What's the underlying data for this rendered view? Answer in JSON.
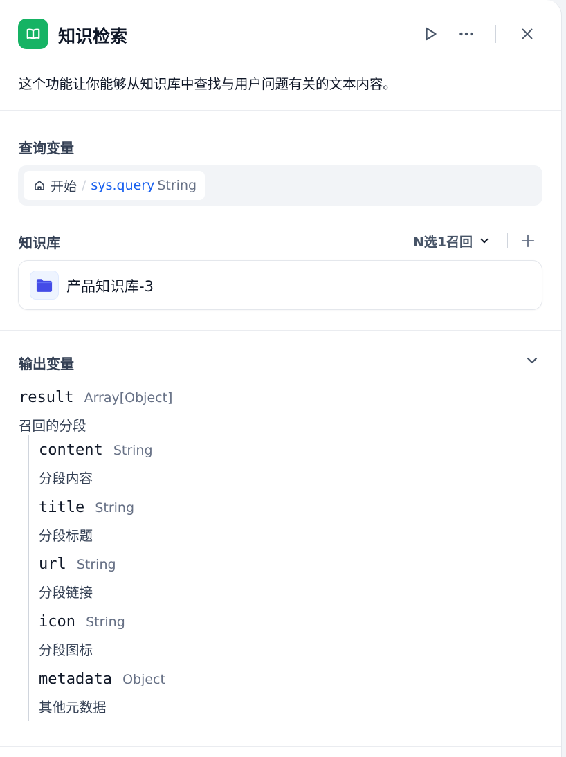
{
  "header": {
    "title": "知识检索",
    "description": "这个功能让你能够从知识库中查找与用户问题有关的文本内容。"
  },
  "query_section": {
    "label": "查询变量",
    "node_name": "开始",
    "separator": "/",
    "variable": "sys.query",
    "variable_type": "String"
  },
  "knowledge_section": {
    "label": "知识库",
    "retrieval_mode": "N选1召回",
    "items": [
      {
        "name": "产品知识库-3"
      }
    ]
  },
  "output_section": {
    "label": "输出变量",
    "root": {
      "name": "result",
      "type": "Array[Object]",
      "description": "召回的分段"
    },
    "fields": [
      {
        "name": "content",
        "type": "String",
        "description": "分段内容"
      },
      {
        "name": "title",
        "type": "String",
        "description": "分段标题"
      },
      {
        "name": "url",
        "type": "String",
        "description": "分段链接"
      },
      {
        "name": "icon",
        "type": "String",
        "description": "分段图标"
      },
      {
        "name": "metadata",
        "type": "Object",
        "description": "其他元数据"
      }
    ]
  },
  "colors": {
    "accent_green": "#16b364",
    "link_blue": "#155eef",
    "folder_blue": "#444ce7"
  }
}
